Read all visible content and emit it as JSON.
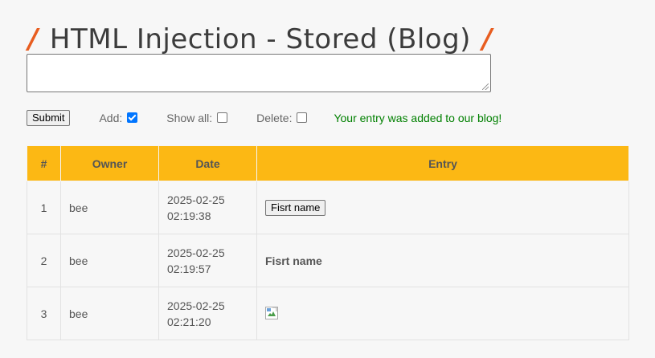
{
  "header": {
    "title": "HTML Injection - Stored (Blog)",
    "slash_left": "/",
    "slash_right": "/",
    "slash_color": "#e85d20"
  },
  "form": {
    "entry_value": "",
    "submit_label": "Submit",
    "add_label": "Add:",
    "add_checked": true,
    "show_all_label": "Show all:",
    "show_all_checked": false,
    "delete_label": "Delete:",
    "delete_checked": false,
    "status_message": "Your entry was added to our blog!",
    "status_color": "#008000"
  },
  "table": {
    "header_color": "#fcb814",
    "columns": [
      "#",
      "Owner",
      "Date",
      "Entry"
    ],
    "rows": [
      {
        "num": "1",
        "owner": "bee",
        "date": "2025-02-25",
        "time": "02:19:38",
        "entry_type": "button",
        "entry": "Fisrt name"
      },
      {
        "num": "2",
        "owner": "bee",
        "date": "2025-02-25",
        "time": "02:19:57",
        "entry_type": "bold",
        "entry": "Fisrt name"
      },
      {
        "num": "3",
        "owner": "bee",
        "date": "2025-02-25",
        "time": "02:21:20",
        "entry_type": "broken-image",
        "entry": "broken-image-icon"
      }
    ]
  }
}
